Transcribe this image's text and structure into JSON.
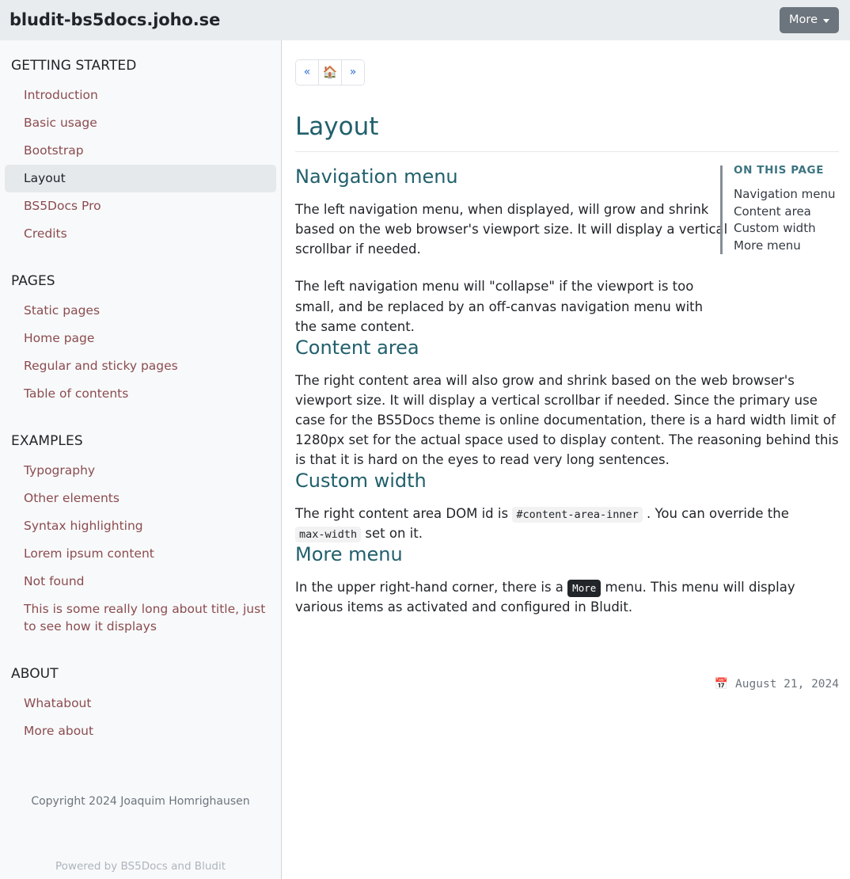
{
  "header": {
    "brand": "bludit-bs5docs.joho.se",
    "more_button": {
      "label": "More",
      "caret_icon": "chevron-down-icon"
    }
  },
  "sidebar": {
    "sections": [
      {
        "title": "GETTING STARTED",
        "items": [
          {
            "label": "Introduction",
            "active": false
          },
          {
            "label": "Basic usage",
            "active": false
          },
          {
            "label": "Bootstrap",
            "active": false
          },
          {
            "label": "Layout",
            "active": true
          },
          {
            "label": "BS5Docs Pro",
            "active": false
          },
          {
            "label": "Credits",
            "active": false
          }
        ]
      },
      {
        "title": "PAGES",
        "items": [
          {
            "label": "Static pages",
            "active": false
          },
          {
            "label": "Home page",
            "active": false
          },
          {
            "label": "Regular and sticky pages",
            "active": false
          },
          {
            "label": "Table of contents",
            "active": false
          }
        ]
      },
      {
        "title": "EXAMPLES",
        "items": [
          {
            "label": "Typography",
            "active": false
          },
          {
            "label": "Other elements",
            "active": false
          },
          {
            "label": "Syntax highlighting",
            "active": false
          },
          {
            "label": "Lorem ipsum content",
            "active": false
          },
          {
            "label": "Not found",
            "active": false
          },
          {
            "label": "This is some really long about title, just to see how it displays",
            "active": false
          }
        ]
      },
      {
        "title": "ABOUT",
        "items": [
          {
            "label": "Whatabout",
            "active": false
          },
          {
            "label": "More about",
            "active": false
          }
        ]
      }
    ],
    "footer": {
      "copyright": "Copyright 2024 Joaquim Homrighausen",
      "powered_by": "Powered by BS5Docs and Bludit"
    }
  },
  "main": {
    "pager": {
      "previous_label": "«",
      "home_icon": "🏠",
      "next_label": "»"
    },
    "page_title": "Layout",
    "sections": [
      {
        "heading": "Navigation menu",
        "paragraphs": [
          "The left navigation menu, when displayed, will grow and shrink based on the web browser's viewport size. It will display a vertical scrollbar if needed.",
          "The left navigation menu will \"collapse\" if the viewport is too small, and be replaced by an off-canvas navigation menu with the same content."
        ]
      },
      {
        "heading": "Content area",
        "paragraphs": [
          "The right content area will also grow and shrink based on the web browser's viewport size. It will display a vertical scrollbar if needed. Since the primary use case for the BS5Docs theme is online documentation, there is a hard width limit of 1280px set for the actual space used to display content. The reasoning behind this is that it is hard on the eyes to read very long sentences."
        ]
      },
      {
        "heading": "Custom width",
        "paragraph_parts": {
          "before_code1": "The right content area DOM id is",
          "code1": "#content-area-inner",
          "between": ". You can override the",
          "code2": "max-width",
          "after_code2": "set on it."
        }
      },
      {
        "heading": "More menu",
        "paragraph_parts": {
          "before_kbd": "In the upper right-hand corner, there is a",
          "kbd": "More",
          "after_kbd": "menu. This menu will display various items as activated and configured in Bludit."
        }
      }
    ],
    "on_this_page": {
      "title": "ON THIS PAGE",
      "links": [
        "Navigation menu",
        "Content area",
        "Custom width",
        "More menu"
      ]
    },
    "page_date": {
      "calendar_icon": "📅",
      "date": "August 21, 2024"
    }
  },
  "colors": {
    "heading_teal": "#21606c",
    "sidebar_link": "#8b4c50",
    "topbar_bg": "#e9ecef",
    "sidebar_bg": "#f8f9fa",
    "more_button_bg": "#6c757d",
    "pager_link": "#2c6fd1"
  }
}
